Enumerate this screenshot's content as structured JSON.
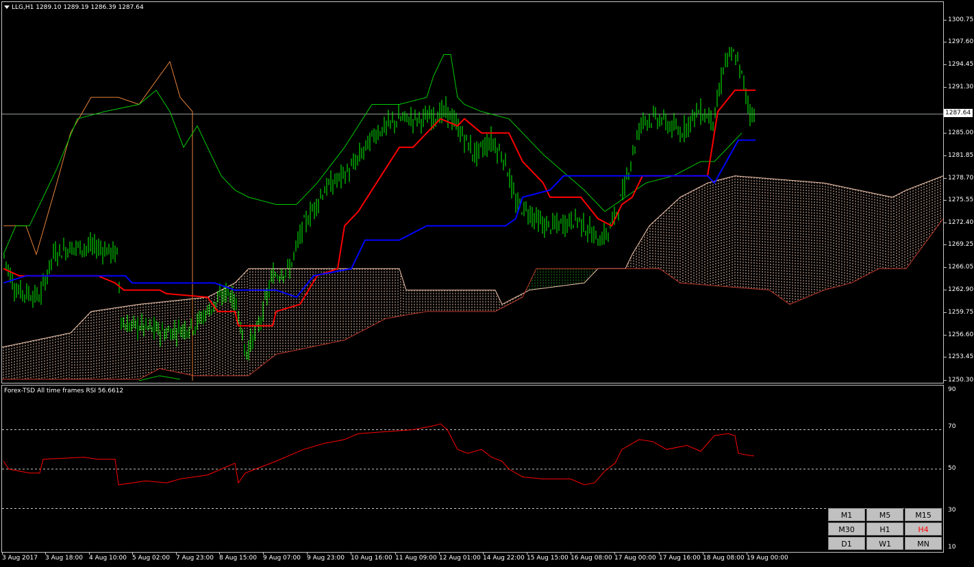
{
  "main_chart": {
    "title_symbol": "LLG,H1",
    "title_ohlc": "1289.10 1289.19 1286.39 1287.64",
    "current_price": "1287.64",
    "price_labels": [
      "1300.75",
      "1297.60",
      "1294.45",
      "1291.30",
      "1287.64",
      "1285.00",
      "1281.85",
      "1278.70",
      "1275.55",
      "1272.40",
      "1269.25",
      "1266.05",
      "1262.90",
      "1259.75",
      "1256.60",
      "1253.45",
      "1250.30"
    ]
  },
  "indicator": {
    "title": "Forex-TSD All time frames RSI 56.6612",
    "levels": [
      "90",
      "70",
      "50",
      "30",
      "10"
    ]
  },
  "time_axis": [
    "3 Aug 2017",
    "3 Aug 18:00",
    "4 Aug 10:00",
    "5 Aug 02:00",
    "7 Aug 23:00",
    "8 Aug 15:00",
    "9 Aug 07:00",
    "9 Aug 23:00",
    "10 Aug 16:00",
    "11 Aug 09:00",
    "12 Aug 01:00",
    "14 Aug 22:00",
    "15 Aug 15:00",
    "16 Aug 08:00",
    "17 Aug 00:00",
    "17 Aug 16:00",
    "18 Aug 08:00",
    "19 Aug 00:00"
  ],
  "timeframes": [
    {
      "label": "M1",
      "active": false
    },
    {
      "label": "M5",
      "active": false
    },
    {
      "label": "M15",
      "active": false
    },
    {
      "label": "M30",
      "active": false
    },
    {
      "label": "H1",
      "active": false
    },
    {
      "label": "H4",
      "active": true
    },
    {
      "label": "D1",
      "active": false
    },
    {
      "label": "W1",
      "active": false
    },
    {
      "label": "MN",
      "active": false
    }
  ],
  "colors": {
    "candles": "#00ff00",
    "tenkan": "#ff0000",
    "kijun": "#0000ff",
    "chikou": "#00cc00",
    "cloud_bull": "#f4c8b0",
    "cloud_bear": "#228b22",
    "rsi": "#ff0000",
    "background": "#000000"
  }
}
